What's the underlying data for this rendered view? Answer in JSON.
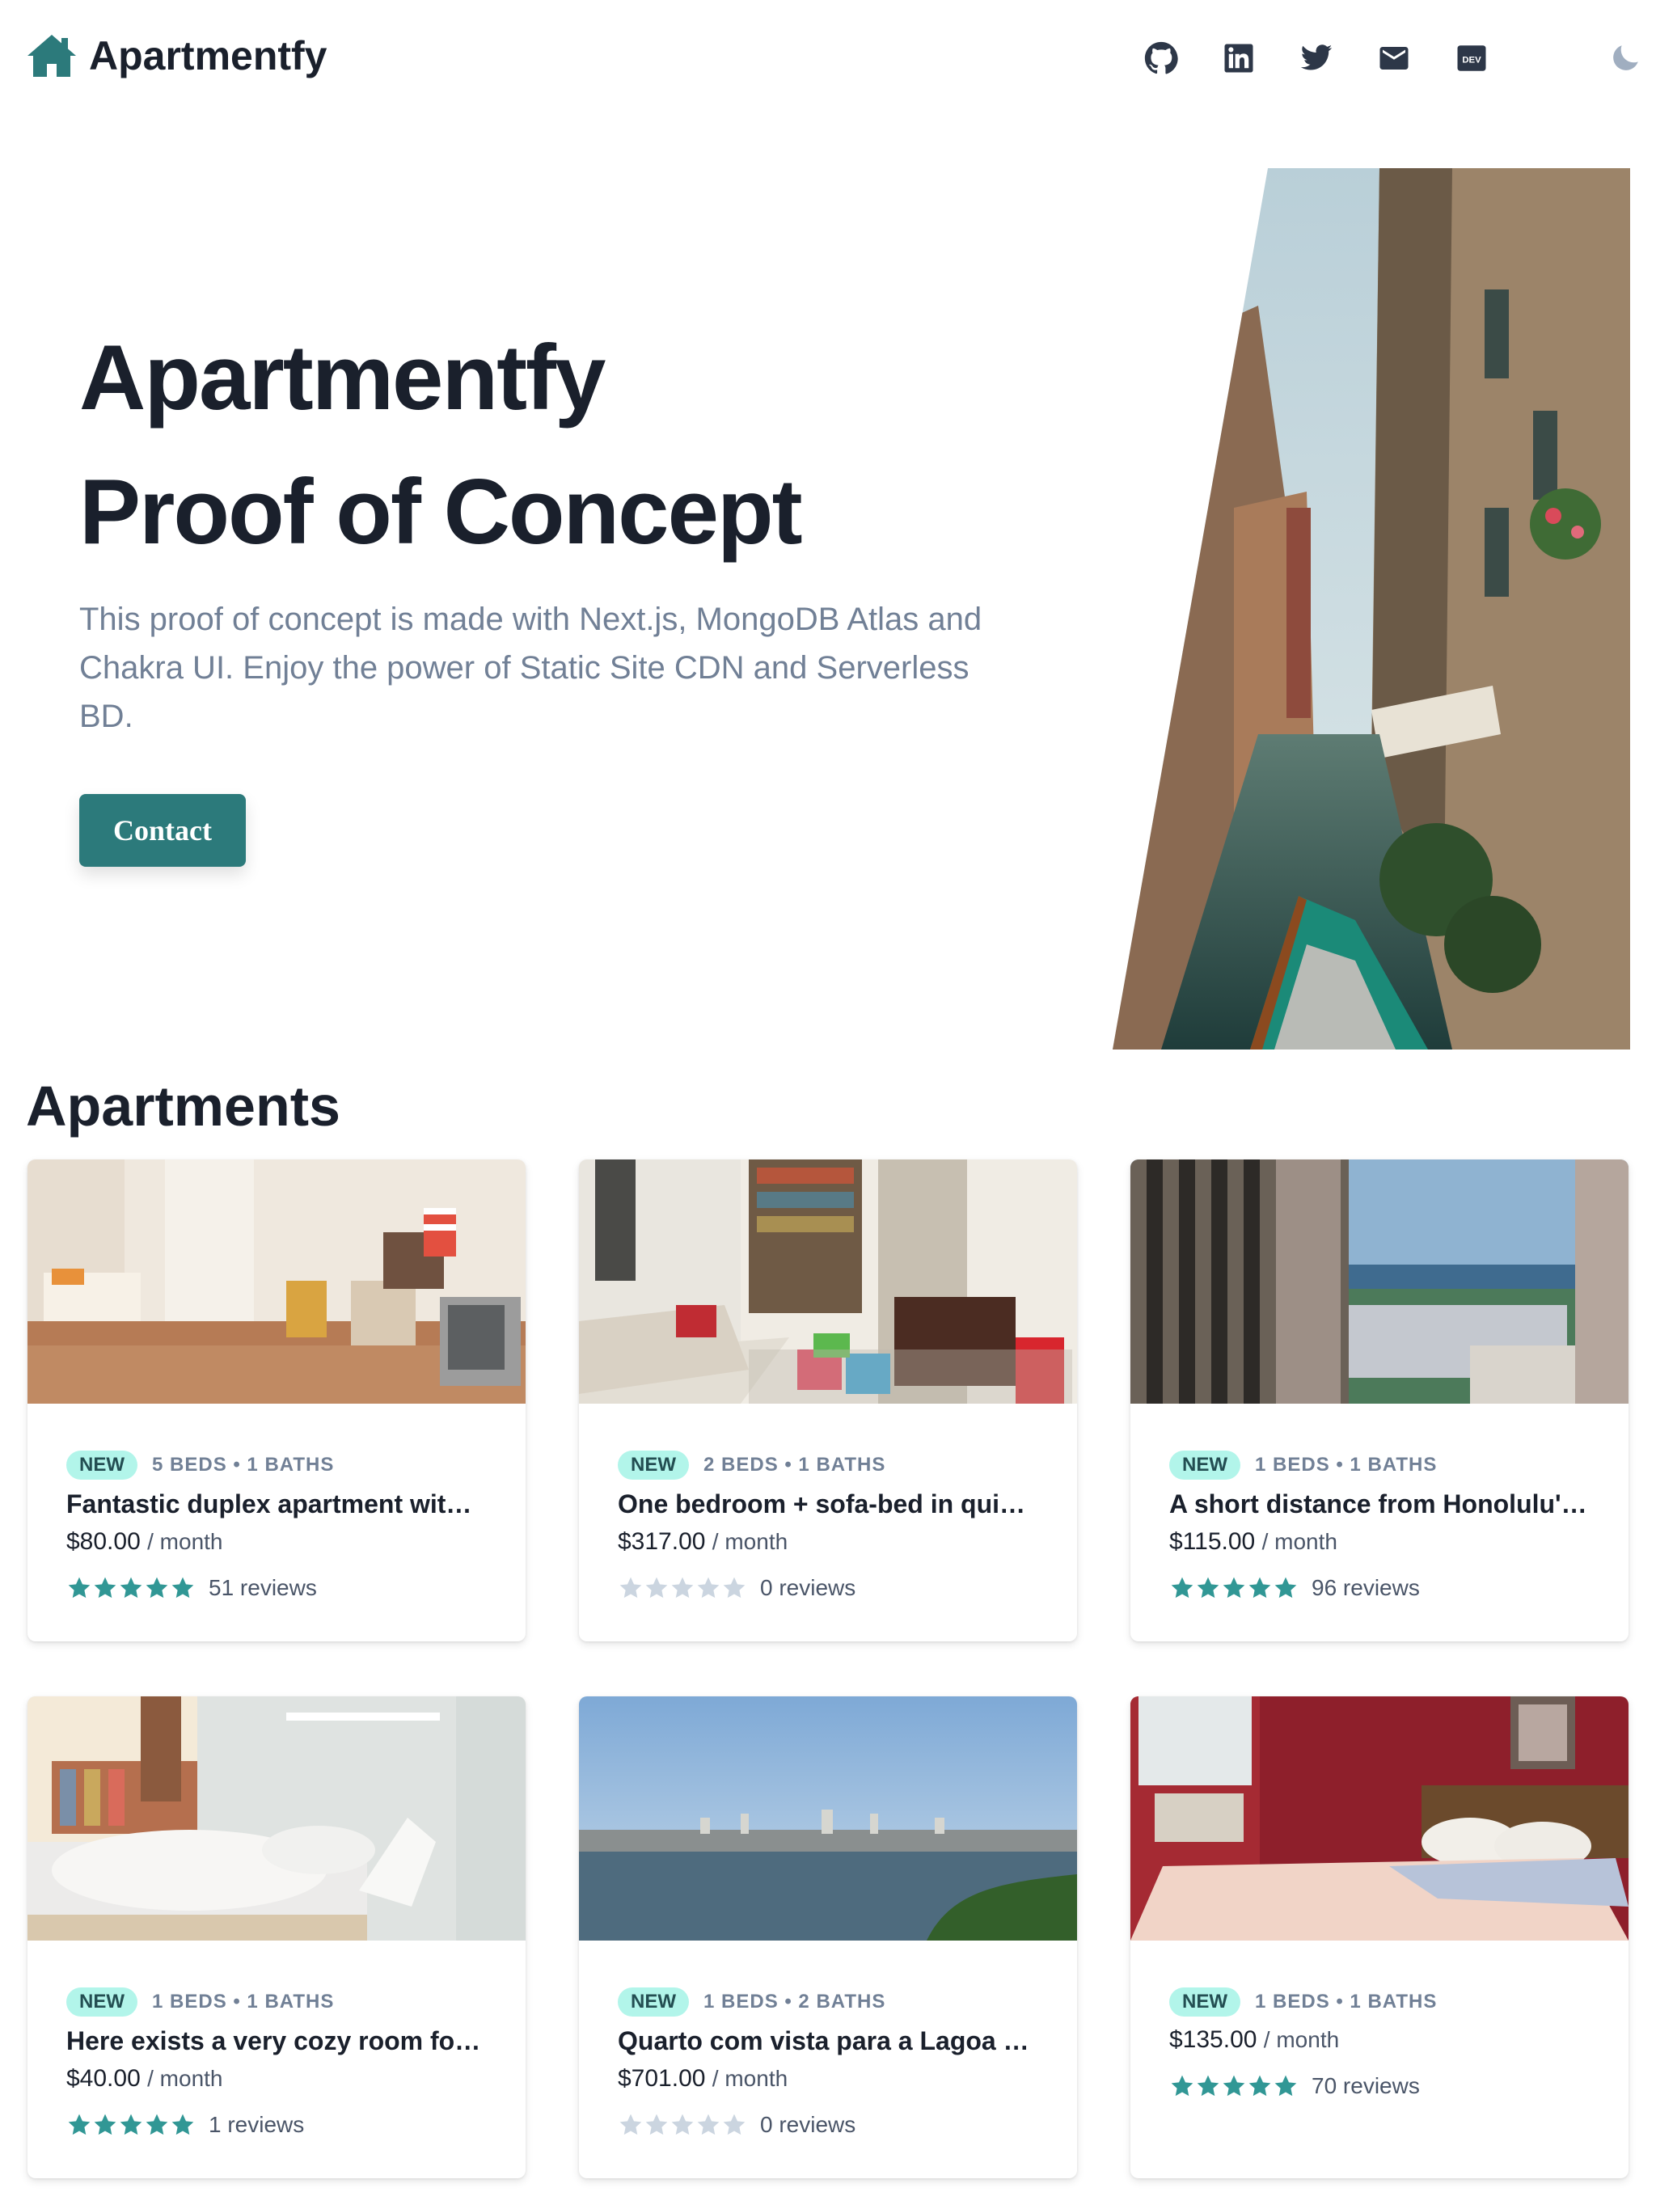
{
  "header": {
    "brand": "Apartmentfy",
    "icons": [
      "github-icon",
      "linkedin-icon",
      "twitter-icon",
      "mail-icon",
      "dev-icon",
      "moon-icon"
    ],
    "dev_label": "DEV"
  },
  "hero": {
    "title_line1": "Apartmentfy",
    "title_line2": "Proof of Concept",
    "description": "This proof of concept is made with Next.js, MongoDB Atlas and Chakra UI. Enjoy the power of Static Site CDN and Serverless BD.",
    "cta_label": "Contact"
  },
  "apartments": {
    "heading": "Apartments",
    "items": [
      {
        "badge": "NEW",
        "meta": "5 BEDS • 1 BATHS",
        "title": "Fantastic duplex apartment wit…",
        "price": "$80.00",
        "per": "/ month",
        "rating": 5,
        "reviews": "51 reviews"
      },
      {
        "badge": "NEW",
        "meta": "2 BEDS • 1 BATHS",
        "title": "One bedroom + sofa-bed in qui…",
        "price": "$317.00",
        "per": "/ month",
        "rating": 0,
        "reviews": "0 reviews"
      },
      {
        "badge": "NEW",
        "meta": "1 BEDS • 1 BATHS",
        "title": "A short distance from Honolulu'…",
        "price": "$115.00",
        "per": "/ month",
        "rating": 5,
        "reviews": "96 reviews"
      },
      {
        "badge": "NEW",
        "meta": "1 BEDS • 1 BATHS",
        "title": "Here exists a very cozy room fo…",
        "price": "$40.00",
        "per": "/ month",
        "rating": 5,
        "reviews": "1 reviews"
      },
      {
        "badge": "NEW",
        "meta": "1 BEDS • 2 BATHS",
        "title": "Quarto com vista para a Lagoa …",
        "price": "$701.00",
        "per": "/ month",
        "rating": 0,
        "reviews": "0 reviews"
      },
      {
        "badge": "NEW",
        "meta": "1 BEDS • 1 BATHS",
        "title": "",
        "price": "$135.00",
        "per": "/ month",
        "rating": 5,
        "reviews": "70 reviews"
      }
    ]
  },
  "colors": {
    "accent": "#2c7a7b",
    "star_filled": "#319795",
    "star_empty": "#cbd5e0",
    "badge_bg": "#b2f5ea"
  }
}
